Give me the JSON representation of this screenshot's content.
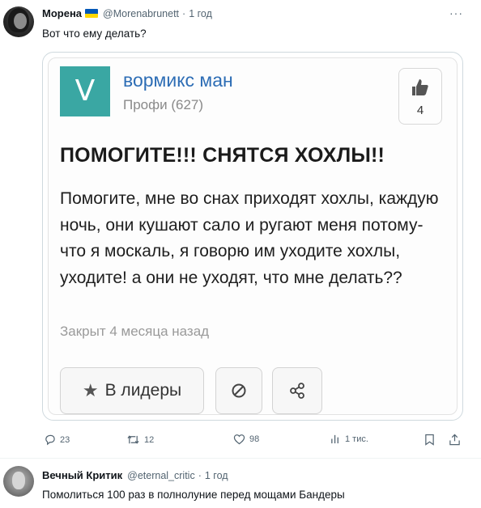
{
  "tweet": {
    "author": "Морена",
    "handle": "@Morenabrunett",
    "time": "1 год",
    "text": "Вот что ему делать?",
    "more": "···"
  },
  "card": {
    "logo_letter": "V",
    "username": "вормикс ман",
    "rank": "Профи (627)",
    "likes": "4",
    "title": "ПОМОГИТЕ!!! СНЯТСЯ ХОХЛЫ!!",
    "body": "Помогите, мне во снах приходят хохлы, каждую ночь, они кушают сало и ругают меня потому-что я москаль, я говорю им уходите хохлы, уходите! а они не уходят, что мне делать??",
    "closed": "Закрыт 4 месяца назад",
    "leaders_button": "В лидеры",
    "star": "★"
  },
  "actions": {
    "replies": "23",
    "retweets": "12",
    "likes": "98",
    "views": "1 тис."
  },
  "reply": {
    "author": "Вечный Критик",
    "handle": "@eternal_critic",
    "time": "1 год",
    "text": "Помолиться 100 раз в полнолуние перед мощами Бандеры"
  },
  "colors": {
    "accent_blue": "#2d6db5",
    "logo_teal": "#3aa7a3",
    "muted": "#536471",
    "flag_blue": "#0057b7",
    "flag_yellow": "#ffd700"
  },
  "icons": [
    "reply-icon",
    "retweet-icon",
    "heart-icon",
    "views-icon",
    "bookmark-icon",
    "share-icon",
    "thumbs-up-icon",
    "ban-icon",
    "share-nodes-icon",
    "star-icon"
  ]
}
